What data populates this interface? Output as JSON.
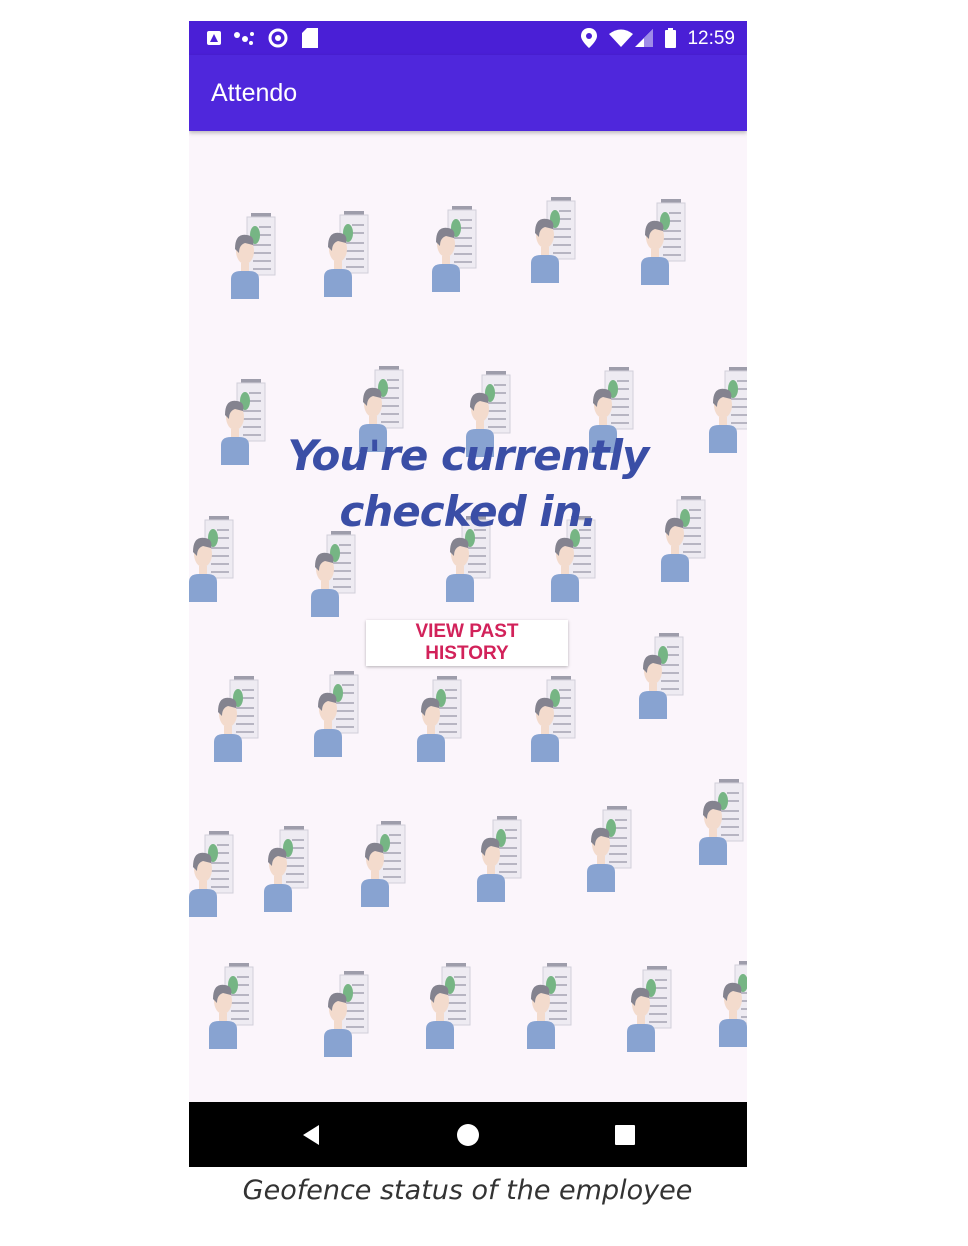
{
  "status_bar": {
    "time": "12:59",
    "left_icons": [
      "app-notification-icon",
      "network-sharing-icon",
      "sync-icon",
      "sd-card-icon"
    ],
    "right_icons": [
      "location-icon",
      "wifi-icon",
      "cellular-signal-icon",
      "battery-icon"
    ]
  },
  "app_bar": {
    "title": "Attendo"
  },
  "main": {
    "status_message": "You're currently checked in.",
    "history_button_label": "VIEW PAST HISTORY",
    "background_icon": "employee-checklist-icon"
  },
  "nav_bar": {
    "buttons": [
      "back-icon",
      "home-icon",
      "recents-icon"
    ]
  },
  "caption": "Geofence status of the employee",
  "colors": {
    "app_bar": "#4f27dc",
    "status_bar": "#4a1fd6",
    "background": "#fbf5fb",
    "status_text": "#3a4ea6",
    "button_text": "#d2225a"
  }
}
